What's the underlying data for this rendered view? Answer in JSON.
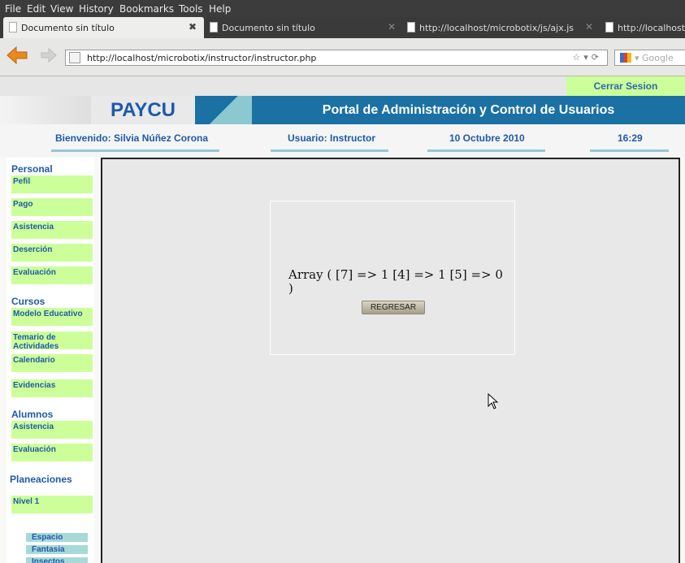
{
  "menubar": {
    "items": [
      "File",
      "Edit",
      "View",
      "History",
      "Bookmarks",
      "Tools",
      "Help"
    ]
  },
  "tabs": [
    {
      "title": "Documento sin título"
    },
    {
      "title": "Documento sin título"
    },
    {
      "title": "http://localhost/microbotix/js/ajx.js"
    },
    {
      "title": "http://localhost"
    }
  ],
  "navbar": {
    "url": "http://localhost/microbotix/instructor/instructor.php",
    "search_placeholder": "Google"
  },
  "page": {
    "logout_label": "Cerrar Sesion",
    "logo": "PAYCU",
    "portal_title": "Portal de Administración y Control de Usuarios",
    "welcome": "Bienvenido: Silvia Núñez Corona",
    "user": "Usuario: Instructor",
    "date": "10 Octubre 2010",
    "time": "16:29"
  },
  "sidebar": {
    "personal_heading": "Personal",
    "personal_items": [
      "Pefil",
      "Pago",
      "Asistencia",
      "Deserción",
      "Evaluación"
    ],
    "cursos_heading": "Cursos",
    "cursos_items": [
      "Modelo Educativo",
      "Temario de Actividades",
      "Calendario",
      "Evidencias"
    ],
    "alumnos_heading": "Alumnos",
    "alumnos_items": [
      "Asistencia",
      "Evaluación"
    ],
    "planeaciones_heading": "Planeaciones",
    "planeaciones_items": [
      "Nivel 1"
    ],
    "nivel1_sub": [
      "Espacio",
      "Fantasia",
      "Insectos"
    ]
  },
  "content": {
    "message": "Array ( [7] => 1 [4] => 1 [5] => 0 )",
    "button_label": "REGRESAR"
  }
}
